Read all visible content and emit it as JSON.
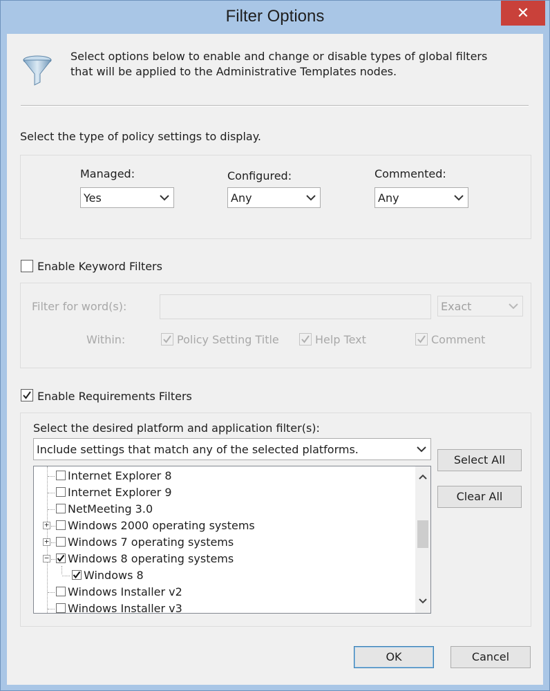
{
  "window": {
    "title": "Filter Options",
    "close_glyph": "✕"
  },
  "intro_text": "Select options below to enable and change or disable types of global filters that will be applied to the Administrative Templates nodes.",
  "policy_section": {
    "heading": "Select the type of policy settings to display.",
    "managed": {
      "label": "Managed:",
      "value": "Yes"
    },
    "configured": {
      "label": "Configured:",
      "value": "Any"
    },
    "commented": {
      "label": "Commented:",
      "value": "Any"
    }
  },
  "keyword": {
    "enable_label": "Enable Keyword Filters",
    "enabled": false,
    "filter_label": "Filter for word(s):",
    "filter_value": "",
    "match_value": "Exact",
    "within_label": "Within:",
    "within_policy_title": "Policy Setting Title",
    "within_help_text": "Help Text",
    "within_comment": "Comment"
  },
  "requirements": {
    "enable_label": "Enable Requirements Filters",
    "enabled": true,
    "select_label": "Select the desired platform and application filter(s):",
    "mode_value": "Include settings that match any of the selected platforms.",
    "select_all_label": "Select All",
    "clear_all_label": "Clear All",
    "tree": [
      {
        "label": "Internet Explorer 8",
        "checked": false
      },
      {
        "label": "Internet Explorer 9",
        "checked": false
      },
      {
        "label": "NetMeeting 3.0",
        "checked": false
      },
      {
        "label": "Windows 2000 operating systems",
        "checked": false,
        "expander": "+"
      },
      {
        "label": "Windows 7 operating systems",
        "checked": false,
        "expander": "+"
      },
      {
        "label": "Windows 8 operating systems",
        "checked": true,
        "expander": "−"
      },
      {
        "label": "Windows 8",
        "checked": true
      },
      {
        "label": "Windows Installer v2",
        "checked": false
      },
      {
        "label": "Windows Installer v3",
        "checked": false
      }
    ]
  },
  "footer": {
    "ok_label": "OK",
    "cancel_label": "Cancel"
  },
  "colors": {
    "titlebar": "#a9c6e6",
    "close": "#c9413a",
    "dialog_bg": "#f0f0f0"
  }
}
